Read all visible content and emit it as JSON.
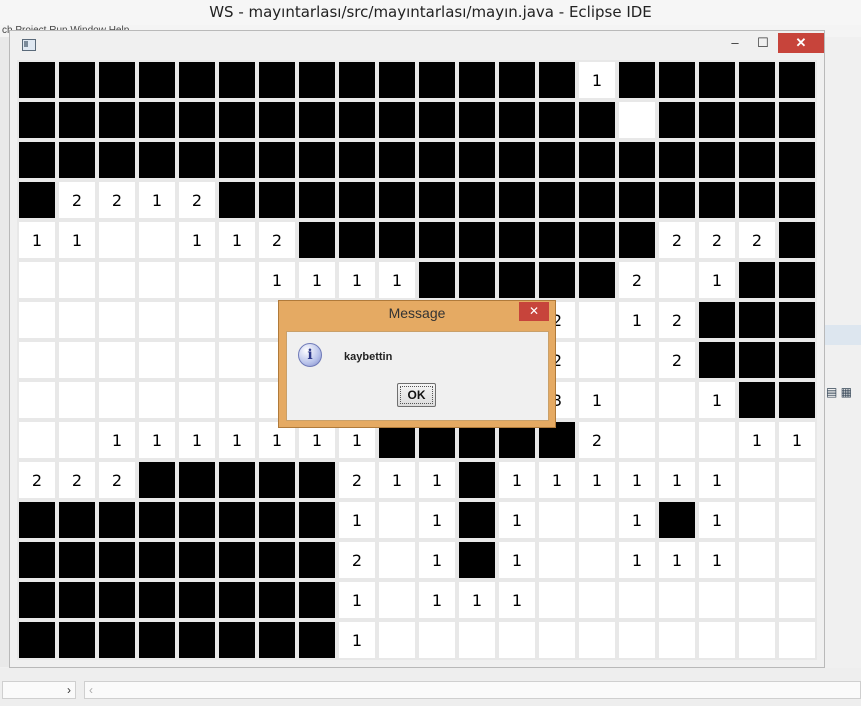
{
  "eclipse": {
    "title": "WS - mayıntarlası/src/mayıntarlası/mayın.java - Eclipse IDE",
    "menubar_partial": "ch   Project   Run   Window   Help",
    "scroll_left_arrow": "›",
    "scroll_right_arrow": "‹"
  },
  "frame": {
    "minimize_glyph": "‒",
    "maximize_glyph": "☐",
    "close_glyph": "✕"
  },
  "board": {
    "rows": 15,
    "cols": 20,
    "grid": [
      "##############1#####",
      "###############.####",
      "####################",
      "#2212###############",
      "11..112#########222##",
      "......1111#####2.1##",
      ".......######2.12#",
      ".......######2..2#",
      ".......######31..1#",
      "..1111111#####2...11",
      "222#####211#111111..",
      "########1.1#1..1#1..",
      "########2.1#1..111..",
      "########1.111.......",
      "########1..........."
    ]
  },
  "dialog": {
    "title": "Message",
    "close_glyph": "✕",
    "icon_glyph": "i",
    "message": "kaybettin",
    "ok_label": "OK"
  }
}
